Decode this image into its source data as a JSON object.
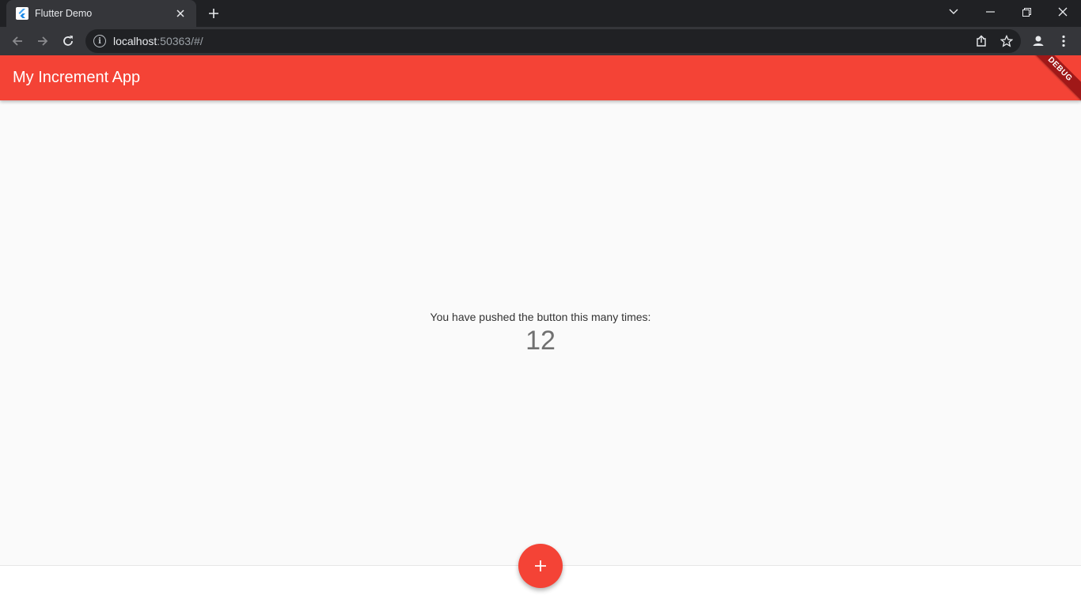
{
  "browser": {
    "tab": {
      "title": "Flutter Demo",
      "favicon": "flutter-icon"
    },
    "address_bar": {
      "host": "localhost",
      "rest": ":50363/#/"
    }
  },
  "app": {
    "title": "My Increment App",
    "debug_banner": "DEBUG",
    "caption": "You have pushed the button this many times:",
    "counter": "12",
    "fab_icon": "add-icon"
  },
  "colors": {
    "primary": "#f44336",
    "background": "#fafafa"
  }
}
